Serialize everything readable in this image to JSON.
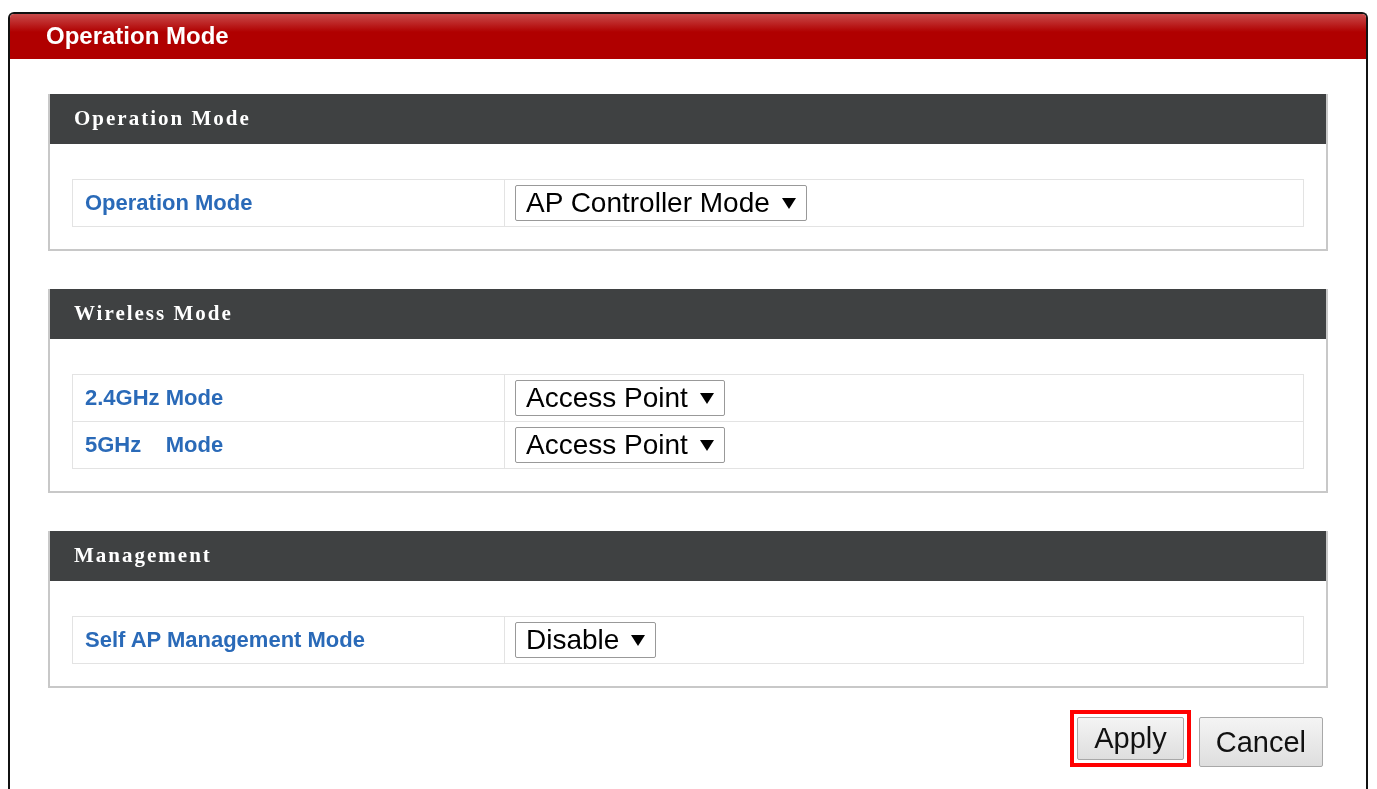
{
  "window": {
    "title": "Operation Mode"
  },
  "sections": [
    {
      "title": "Operation Mode",
      "rows": [
        {
          "label": "Operation Mode",
          "value": "AP Controller Mode"
        }
      ]
    },
    {
      "title": "Wireless Mode",
      "rows": [
        {
          "label": "2.4GHz Mode",
          "value": "Access Point"
        },
        {
          "label": "5GHz    Mode",
          "value": "Access Point"
        }
      ]
    },
    {
      "title": "Management",
      "rows": [
        {
          "label": "Self AP Management Mode",
          "value": "Disable"
        }
      ]
    }
  ],
  "buttons": [
    {
      "label": "Apply",
      "highlighted": true
    },
    {
      "label": "Cancel",
      "highlighted": false
    }
  ]
}
